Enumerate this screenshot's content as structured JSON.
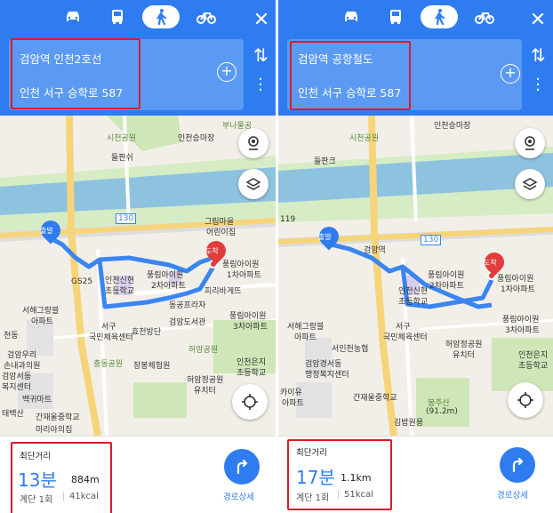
{
  "left": {
    "origin": "검암역 인천2호선",
    "destination": "인천 서구 승학로 587",
    "map_labels": {
      "park1": "부나물공",
      "golf": "인천승마장",
      "park2": "시천공원",
      "flower": "들판쉬",
      "village": "그림마을",
      "kinder": "어린이집",
      "dest_pin": "도착",
      "start_pin": "출발",
      "apt_a": "풍림아이원",
      "apt_a2": "2차아파트",
      "apt_b": "풍림아이원",
      "apt_b2": "1차아파트",
      "gs": "GS25",
      "school": "인천신현",
      "school2": "초등학교",
      "pharm": "피리바게뜨",
      "apt_c": "동공프라자",
      "library": "검암도서관",
      "center": "서구",
      "center2": "국민체육센터",
      "apt_d": "풍림아이원",
      "apt_d2": "3차아파트",
      "hyo": "효천방단",
      "park3": "허암공원",
      "chung": "충동공원",
      "jang": "장봉체험원",
      "apt_e": "서해그랑블",
      "apt_e2": "아파트",
      "kinder2": "허암정공원",
      "kinder2b": "유치터",
      "school3": "인천은지",
      "school3b": "초등학교",
      "apt_f": "천동",
      "apt_g": "검암우리",
      "apt_g2": "손내과의원",
      "apt_h": "검암서동",
      "apt_h2": "복지센터",
      "apt_i": "태백산",
      "apt_j": "백귀마트",
      "apt_k": "간재울중학교",
      "apt_l": "마리아의집",
      "road_num": "130"
    },
    "summary_tag": "최단거리",
    "time": "13분",
    "distance": "884m",
    "stairs": "계단 1회",
    "calories": "41kcal",
    "go_label": "경로상세"
  },
  "right": {
    "origin": "검암역 공항철도",
    "destination": "인천 서구 승학로 587",
    "map_labels": {
      "golf": "인천승마장",
      "park2": "시천공원",
      "flower": "들판크",
      "dest_pin": "도착",
      "start_pin": "출발",
      "gum": "검암역",
      "apt_a": "풍림아이원",
      "apt_a2": "2차아파트",
      "apt_b": "풍림아이원",
      "apt_b2": "1차아파트",
      "school": "인천신현",
      "school2": "초등학교",
      "apt_d": "풍림아이원",
      "apt_d2": "3차아파트",
      "center": "서구",
      "center2": "국민체육센터",
      "seo": "서인천농협",
      "apt_e": "서해그랑블",
      "apt_e2": "아파트",
      "gum2": "검암경서동",
      "gum2b": "행정복지센터",
      "heo": "허암정공원",
      "heob": "유치터",
      "school3": "인천은지",
      "school3b": "초등학교",
      "mtn": "봉주산",
      "mtn2": "(91.2m)",
      "gan": "간재울중학교",
      "gimbap": "김밥원용",
      "k1": "카이유",
      "k2": "아파트",
      "num": "119",
      "road_num": "130"
    },
    "summary_tag": "최단거리",
    "time": "17분",
    "distance": "1.1km",
    "stairs": "계단 1회",
    "calories": "51kcal",
    "go_label": "경로상세"
  },
  "colors": {
    "header": "#2f7cf0",
    "routebox": "#5b9af3",
    "highlight": "#d81c2c",
    "river": "#8ec3e0",
    "green": "#cfe6b8",
    "road": "#f6d47a",
    "route": "#3a85f0",
    "pin_start": "#2f7cf0",
    "pin_end": "#e23c3c"
  },
  "icons": [
    "car-icon",
    "bus-icon",
    "walk-icon",
    "bike-icon",
    "close-icon",
    "swap-icon",
    "more-icon",
    "add-icon",
    "marker-icon",
    "layers-icon",
    "locate-icon",
    "direction-icon"
  ]
}
